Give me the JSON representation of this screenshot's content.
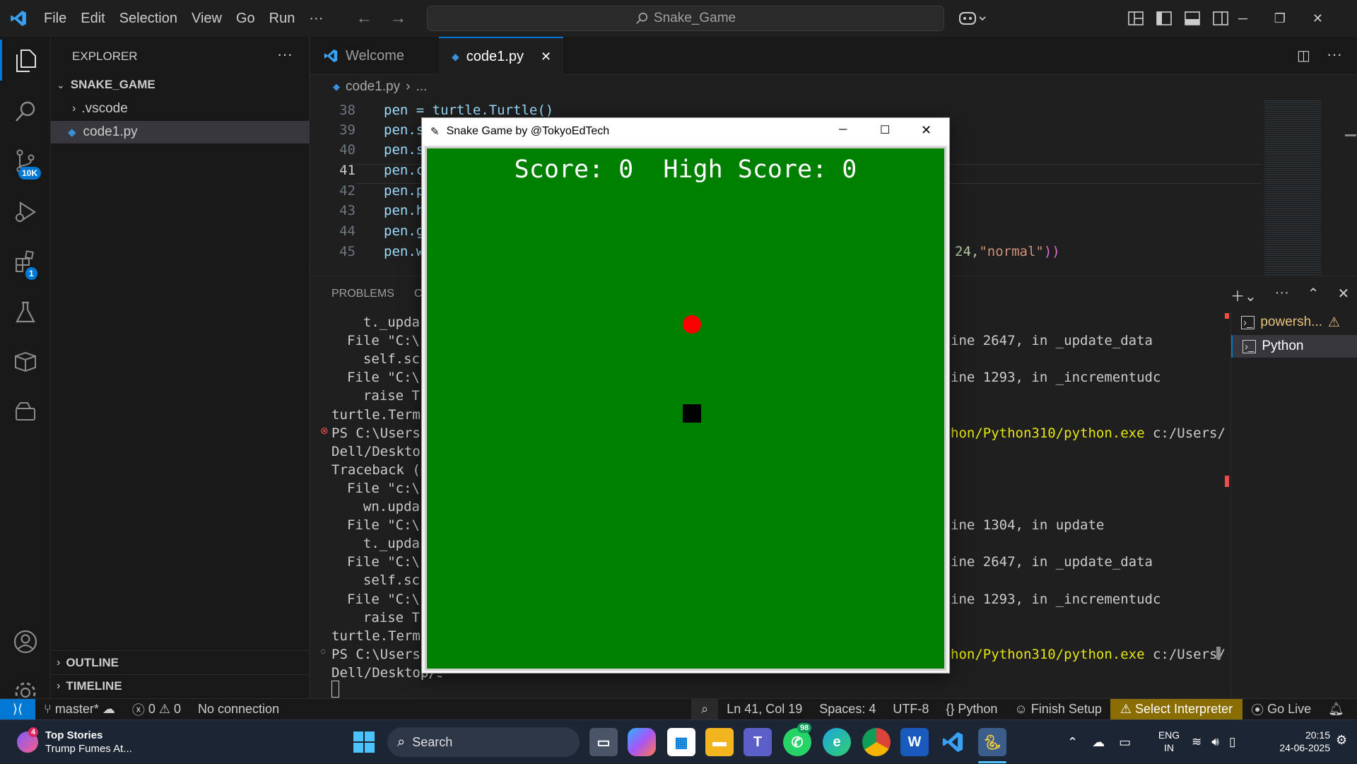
{
  "titlebar": {
    "menu": [
      "File",
      "Edit",
      "Selection",
      "View",
      "Go",
      "Run",
      "···"
    ],
    "search": "Snake_Game"
  },
  "activity": {
    "scm_badge": "10K",
    "extensions_badge": "1"
  },
  "sidebar": {
    "title": "EXPLORER",
    "more": "···",
    "folder": "SNAKE_GAME",
    "items": [
      ".vscode",
      "code1.py"
    ],
    "outline": "OUTLINE",
    "timeline": "TIMELINE"
  },
  "editor": {
    "tabs": [
      "Welcome",
      "code1.py"
    ],
    "breadcrumb_file": "code1.py",
    "breadcrumb_rest": "...",
    "lines": [
      {
        "num": "38",
        "text": "pen = turtle.Turtle()"
      },
      {
        "num": "39",
        "text": "pen.s"
      },
      {
        "num": "40",
        "text": "pen.s"
      },
      {
        "num": "41",
        "text": "pen.c"
      },
      {
        "num": "42",
        "text": "pen.p"
      },
      {
        "num": "43",
        "text": "pen.h"
      },
      {
        "num": "44",
        "text": "pen.g"
      },
      {
        "num": "45",
        "text": "pen.w"
      }
    ],
    "line45_tail_num": "24, ",
    "line45_tail_str": "\"normal\"",
    "line45_tail_end": "))"
  },
  "panel": {
    "tab": "PROBLEMS",
    "tab_partial": "C",
    "terminals": [
      "powersh...",
      "Python"
    ],
    "left_lines": [
      "  t._upda",
      "File \"C:\\",
      "  self.sc",
      "File \"C:\\",
      "  raise T",
      "turtle.Termi",
      "PS C:\\Users\\",
      "Dell/Deskto",
      "Traceback (m",
      "File \"c:\\",
      "  wn.upda",
      "File \"C:\\",
      "  t._upda",
      "File \"C:\\",
      "  self.sc",
      "File \"C:\\",
      "  raise T",
      "turtle.Termi",
      "PS C:\\Users\\",
      "Dell/Desktop/Snake_Game/code1.py"
    ],
    "right_lines": [
      {
        "text": "ine 2647, in _update_data",
        "row": 1,
        "hl": false
      },
      {
        "text": "ine 1293, in _incrementudc",
        "row": 3,
        "hl": false
      },
      {
        "text": "hon/Python310/python.exe",
        "tail": " c:/Users/",
        "row": 6,
        "hl": true
      },
      {
        "text": "ine 1304, in update",
        "row": 11,
        "hl": false
      },
      {
        "text": "ine 2647, in _update_data",
        "row": 13,
        "hl": false
      },
      {
        "text": "ine 1293, in _incrementudc",
        "row": 15,
        "hl": false
      },
      {
        "text": "hon/Python310/python.exe",
        "tail": " c:/Users/",
        "row": 18,
        "hl": true
      }
    ]
  },
  "snake_window": {
    "title": "Snake Game by @TokyoEdTech",
    "score_label": "Score: 0  High Score: 0"
  },
  "statusbar": {
    "branch": "master*",
    "errors": "0",
    "warnings": "0",
    "connection": "No connection",
    "position": "Ln 41, Col 19",
    "spaces": "Spaces: 4",
    "encoding": "UTF-8",
    "language": "Python",
    "finish_setup": "Finish Setup",
    "interpreter": "Select Interpreter",
    "golive": "Go Live"
  },
  "taskbar": {
    "news_title": "Top Stories",
    "news_sub": "Trump Fumes At...",
    "news_badge": "4",
    "search": "Search",
    "whatsapp_badge": "98",
    "lang1": "ENG",
    "lang2": "IN",
    "time": "20:15",
    "date": "24-06-2025"
  },
  "colors": {
    "accent": "#0078d4",
    "game_bg": "#008000",
    "food": "#ff0000",
    "interpreter_bg": "#8a6d00",
    "terminal_yellow": "#e5e510"
  },
  "icons": [
    "vscode-logo-icon",
    "files-icon",
    "search-icon",
    "source-control-icon",
    "run-debug-icon",
    "extensions-icon",
    "testing-icon",
    "remote-explorer-icon",
    "accounts-icon",
    "settings-icon"
  ]
}
